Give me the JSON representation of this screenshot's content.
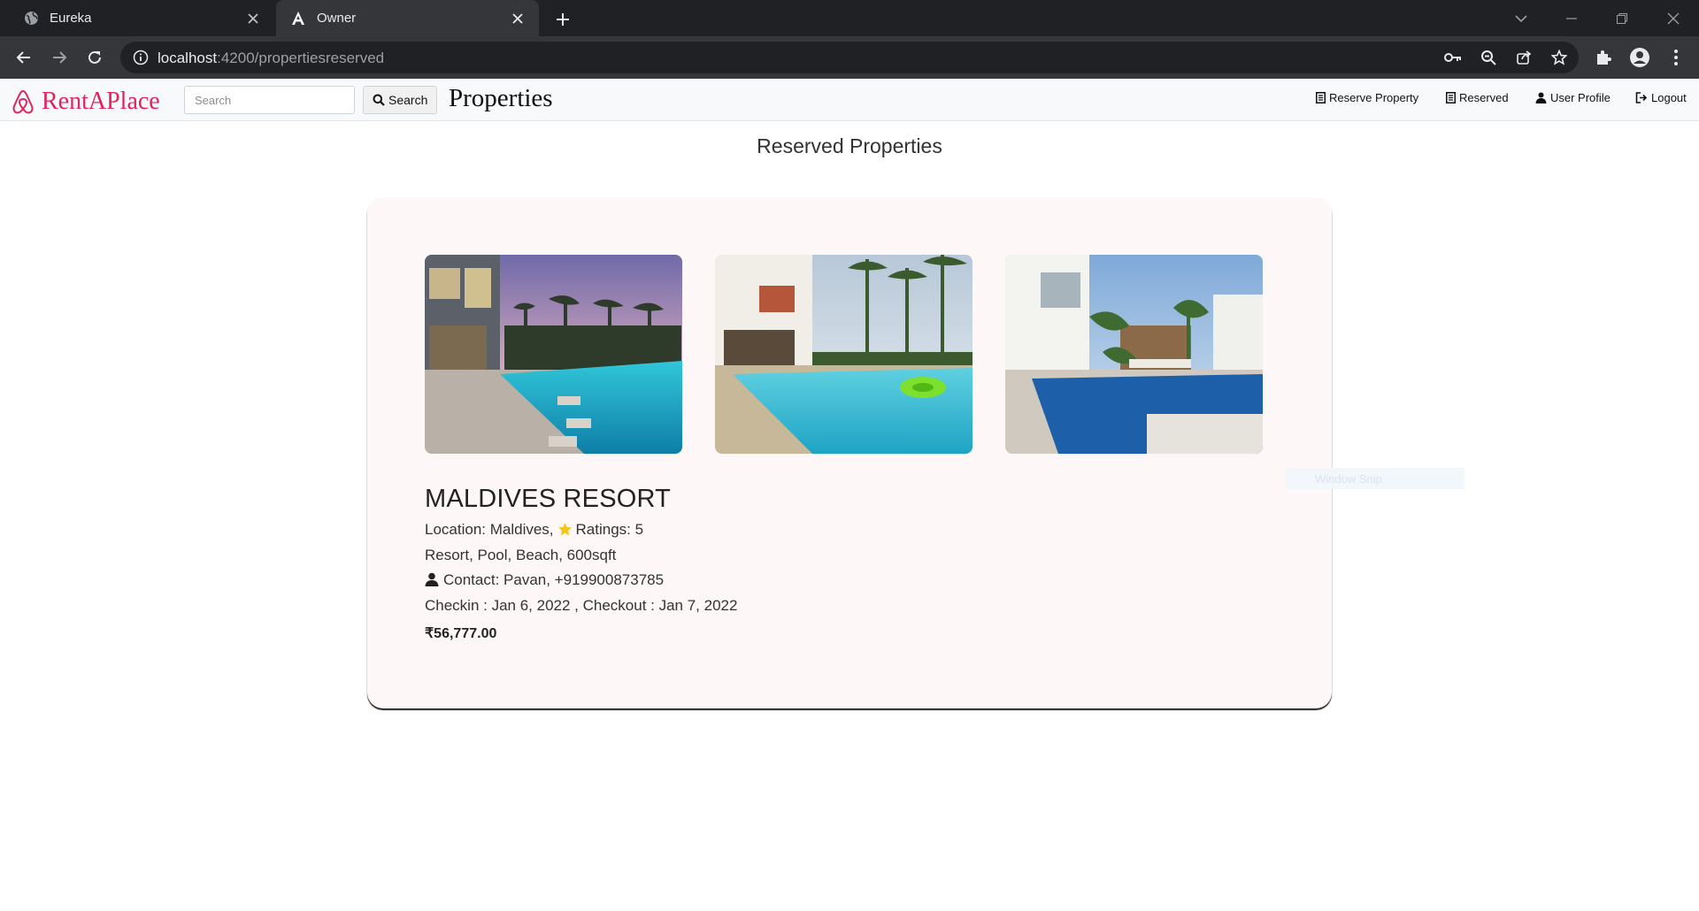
{
  "browser": {
    "tabs": [
      {
        "title": "Eureka",
        "icon": "globe-icon"
      },
      {
        "title": "Owner",
        "icon": "angular-icon"
      }
    ],
    "url_host": "localhost",
    "url_path": ":4200/propertiesreserved"
  },
  "navbar": {
    "brand": "RentAPlace",
    "search_placeholder": "Search",
    "search_button": "Search",
    "heading": "Properties",
    "links": {
      "reserve_property": "Reserve Property",
      "reserved": "Reserved",
      "user_profile": "User Profile",
      "logout": "Logout"
    }
  },
  "page": {
    "title": "Reserved Properties"
  },
  "property": {
    "name": "MALDIVES RESORT",
    "location_label": "Location: Maldives,",
    "ratings_label": "Ratings: 5",
    "features": "Resort, Pool, Beach, 600sqft",
    "contact": "Contact: Pavan, +919900873785",
    "dates": "Checkin : Jan 6, 2022 , Checkout : Jan 7, 2022",
    "price": "₹56,777.00",
    "photos": [
      "pool-villa-dusk-photo",
      "pool-villa-palms-photo",
      "pool-villa-modern-photo"
    ]
  },
  "overlay": {
    "snip_label": "Window Snip"
  },
  "colors": {
    "brand": "#e0245e",
    "star": "#f5c518",
    "card_bg": "#fdf8f7"
  }
}
